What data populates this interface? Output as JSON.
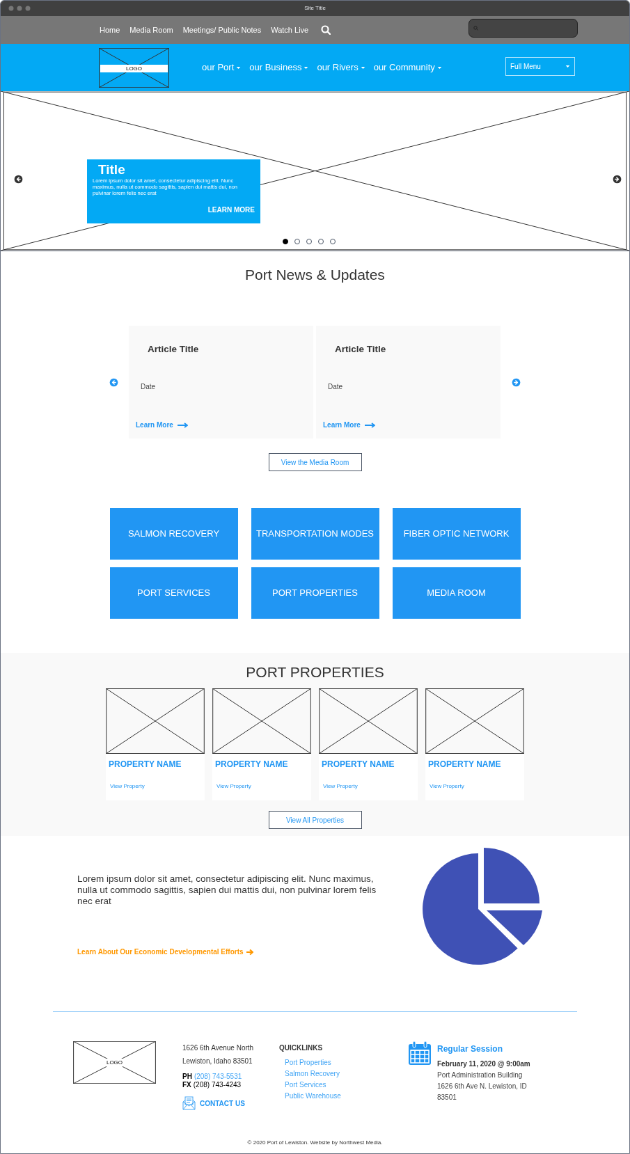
{
  "window": {
    "title": "Site Title"
  },
  "top_nav": {
    "links": [
      "Home",
      "Media Room",
      "Meetings/ Public Notes",
      "Watch Live"
    ]
  },
  "header": {
    "logo": "LOGO",
    "menu": [
      {
        "label": "our Port"
      },
      {
        "label": "our Business"
      },
      {
        "label": "our Rivers"
      },
      {
        "label": "our Community"
      }
    ],
    "full_menu": {
      "value": "Full Menu"
    }
  },
  "hero": {
    "title": "Title",
    "text": "Lorem ipsum dolor sit amet, consectetur adipiscing elit. Nunc maximus, nulla ut commodo sagittis, sapien dui mattis dui, non pulvinar lorem felis nec erat",
    "button": "LEARN MORE",
    "dots": [
      {
        "selected": true
      },
      {
        "selected": false
      },
      {
        "selected": false
      },
      {
        "selected": false
      },
      {
        "selected": false
      }
    ]
  },
  "news": {
    "heading": "Port News & Updates",
    "articles": [
      {
        "title": "Article Title",
        "date": "Date",
        "link": "Learn More"
      },
      {
        "title": "Article Title",
        "date": "Date",
        "link": "Learn More"
      }
    ],
    "button": "View the Media Room"
  },
  "tiles": [
    "SALMON RECOVERY",
    "TRANSPORTATION MODES",
    "FIBER OPTIC NETWORK",
    "PORT SERVICES",
    "PORT PROPERTIES",
    "MEDIA ROOM"
  ],
  "properties": {
    "heading": "PORT PROPERTIES",
    "items": [
      {
        "name": "PROPERTY NAME",
        "link": "View Property"
      },
      {
        "name": "PROPERTY NAME",
        "link": "View Property"
      },
      {
        "name": "PROPERTY NAME",
        "link": "View Property"
      },
      {
        "name": "PROPERTY NAME",
        "link": "View Property"
      }
    ],
    "button": "View All Properties"
  },
  "economic": {
    "text": "Lorem ipsum dolor sit amet, consectetur adipiscing elit. Nunc maximus, nulla ut commodo sagittis, sapien dui mattis dui, non pulvinar lorem felis nec erat",
    "link": "Learn About Our Economic Developmental Efforts"
  },
  "footer": {
    "logo": "LOGO",
    "address": [
      "1626 6th Avenue North",
      "Lewiston, Idaho 83501"
    ],
    "phone": {
      "label": "PH",
      "value": "(208) 743-5531"
    },
    "fax": {
      "label": "FX",
      "value": "(208) 743-4243"
    },
    "contact": "CONTACT US",
    "quicklinks": {
      "heading": "QUICKLINKS",
      "links": [
        "Port Properties",
        "Salmon Recovery",
        "Port Services",
        "Public Warehouse"
      ]
    },
    "event": {
      "title": "Regular Session",
      "date": "February 11, 2020 @ 9:00am",
      "lines": [
        "Port Administration Building",
        "1626 6th Ave N. Lewiston, ID 83501"
      ]
    },
    "copyright": "© 2020 Port of Lewiston. Website by Northwest Media."
  }
}
